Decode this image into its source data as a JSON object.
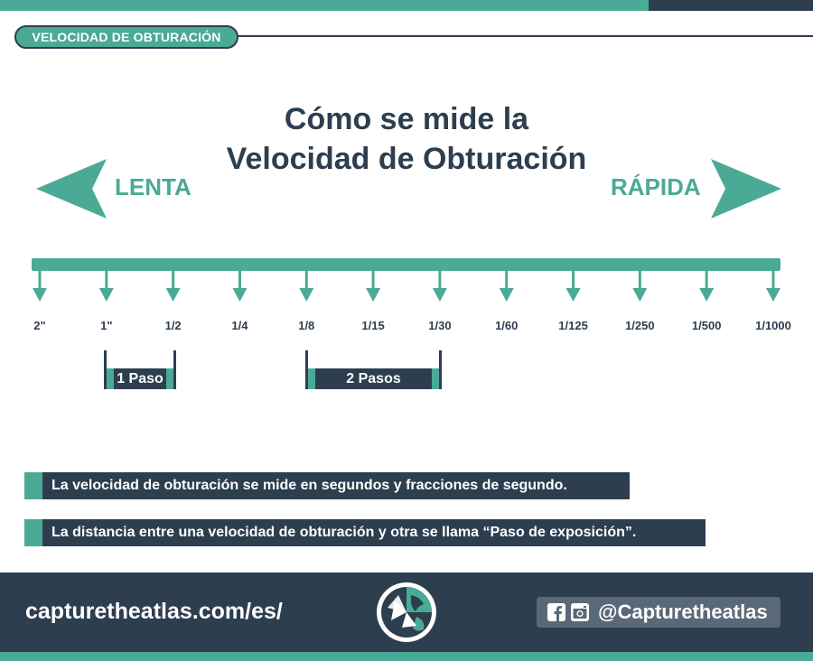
{
  "header": {
    "section_label": "VELOCIDAD DE OBTURACIÓN"
  },
  "title": {
    "line1": "Cómo se mide la",
    "line2": "Velocidad de Obturación"
  },
  "direction": {
    "slow_label": "LENTA",
    "fast_label": "RÁPIDA"
  },
  "timeline": {
    "stops": [
      "2\"",
      "1\"",
      "1/2",
      "1/4",
      "1/8",
      "1/15",
      "1/30",
      "1/60",
      "1/125",
      "1/250",
      "1/500",
      "1/1000"
    ]
  },
  "steps": {
    "one": "1 Paso",
    "two": "2 Pasos"
  },
  "notes": [
    "La velocidad de obturación se mide en segundos y fracciones de segundo.",
    "La distancia entre una velocidad de obturación y otra se llama “Paso de exposición”."
  ],
  "footer": {
    "url": "capturetheatlas.com/es/",
    "handle": "@Capturetheatlas",
    "icons": [
      "facebook-icon",
      "instagram-icon",
      "capture-the-atlas-logo"
    ]
  },
  "colors": {
    "teal": "#4aaa95",
    "navy": "#2d3e4f",
    "white": "#ffffff"
  }
}
